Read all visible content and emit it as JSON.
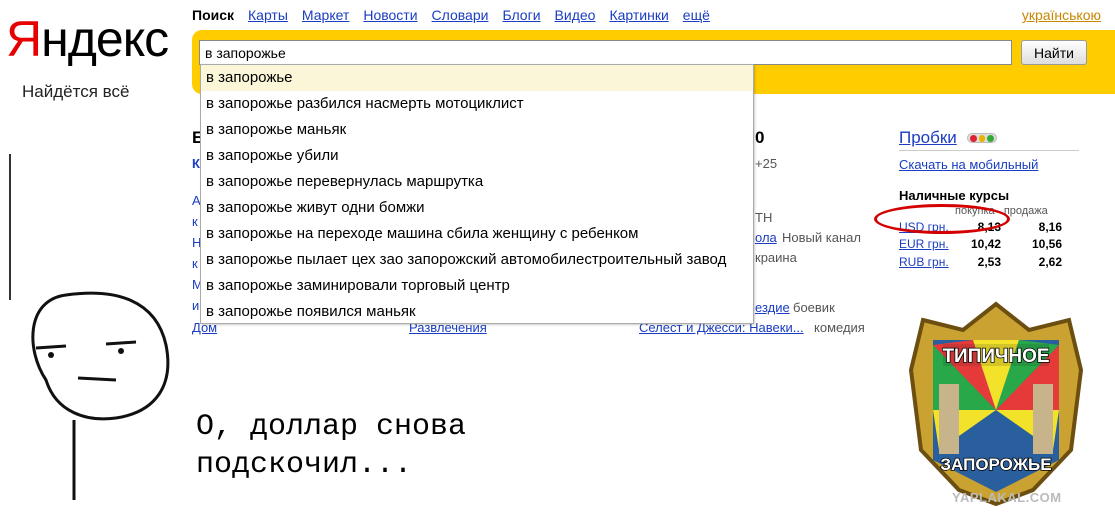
{
  "logo": {
    "first_letter": "Я",
    "rest": "ндекс",
    "tagline": "Найдётся всё"
  },
  "nav": {
    "current": "Поиск",
    "links": [
      "Карты",
      "Маркет",
      "Новости",
      "Словари",
      "Блоги",
      "Видео",
      "Картинки",
      "ещё"
    ],
    "language": "українською"
  },
  "search": {
    "value": "в запорожье",
    "button": "Найти"
  },
  "suggest": [
    "в запорожье",
    "в запорожье разбился насмерть мотоциклист",
    "в запорожье маньяк",
    "в запорожье убили",
    "в запорожье перевернулась маршрутка",
    "в запорожье живут одни бомжи",
    "в запорожье на переходе машина сбила женщину с ребенком",
    "в запорожье пылает цех зао запорожский автомобилестроительный завод",
    "в запорожье заминировали торговый центр",
    "в запорожье появился маньяк"
  ],
  "background": {
    "col1_bottom": "Дом",
    "col2_bottom": "Развлечения",
    "weather_fragment": "0",
    "temp_fragment": "+25",
    "tv_fragment1": "ТН",
    "tv_fragment2": "ола",
    "tv_channel": "Новый канал",
    "tv_fragment3": "краина",
    "movie1": "ездие",
    "movie1_genre": "боевик",
    "movie2": "Селест и Джесси: Навеки...",
    "movie2_genre": "комедия",
    "letter_b": "Б",
    "letter_k": "К"
  },
  "right": {
    "probki": "Пробки",
    "mobile_link": "Скачать на мобильный",
    "rates_title": "Наличные курсы",
    "rates_head_buy": "покупка",
    "rates_head_sell": "продажа",
    "rates": [
      {
        "currency": "USD грн.",
        "buy": "8,13",
        "sell": "8,16"
      },
      {
        "currency": "EUR грн.",
        "buy": "10,42",
        "sell": "10,56"
      },
      {
        "currency": "RUB грн.",
        "buy": "2,53",
        "sell": "2,62"
      }
    ]
  },
  "meme": {
    "caption_line1": "О, доллар снова",
    "caption_line2": "подскочил...",
    "emblem_top": "ТИПИЧНОЕ",
    "emblem_bottom": "ЗАПОРОЖЬЕ",
    "watermark": "YAPLAKAL.COM"
  },
  "colors": {
    "yandex_red": "#e60000",
    "search_band": "#ffcc00",
    "link": "#1a3dc1",
    "highlight_circle": "#d40000"
  }
}
